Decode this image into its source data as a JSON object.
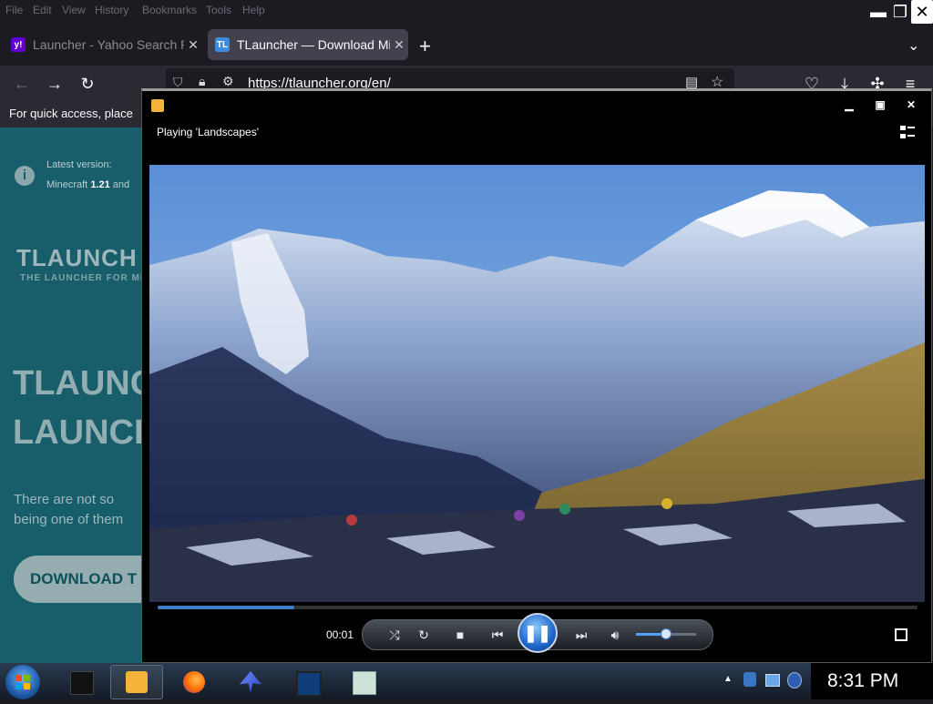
{
  "browser": {
    "menu": [
      "File",
      "Edit",
      "View",
      "History",
      "Bookmarks",
      "Tools",
      "Help"
    ],
    "tabs": [
      {
        "title": "Launcher - Yahoo Search R",
        "active": false
      },
      {
        "title": "TLauncher — Download Mi",
        "active": true
      }
    ],
    "url": "https://tlauncher.org/en/",
    "bookmark_hint": "For quick access, place"
  },
  "page": {
    "latest_label": "Latest version:",
    "latest_version_prefix": "Minecraft",
    "latest_version_number": "1.21",
    "latest_version_suffix": "and",
    "logo": "TLAUNCH",
    "logo_sub": "THE LAUNCHER FOR MI",
    "heading_line1": "TLAUNC",
    "heading_line2": "LAUNCH",
    "body_line1": "There are not so",
    "body_line2": "being one of them",
    "download_button": "DOWNLOAD T"
  },
  "player": {
    "status": "Playing 'Landscapes'",
    "time": "00:01",
    "progress": 0.18,
    "volume": 0.5
  },
  "taskbar": {
    "clock": "8:31 PM"
  },
  "colors": {
    "page_bg": "#175d6a",
    "accent_blue": "#3a7ec9"
  }
}
